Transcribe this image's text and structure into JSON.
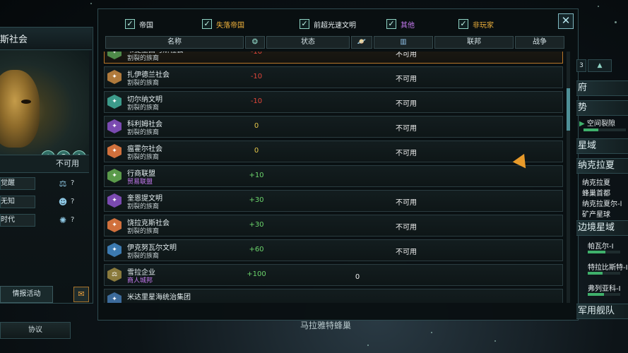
{
  "left_panel": {
    "title": "斯社会",
    "status_value": "不可用",
    "attributes": [
      {
        "label": "觉醒",
        "icon": "scale-icon",
        "glyph": "⚖",
        "value": "?"
      },
      {
        "label": "无知",
        "icon": "person-icon",
        "glyph": "☻",
        "value": "?"
      },
      {
        "label": "时代",
        "icon": "mind-icon",
        "glyph": "✺",
        "value": "?"
      }
    ],
    "ethics": [
      {
        "icon": "balance-ethic-icon",
        "glyph": "⚖"
      },
      {
        "icon": "peace-ethic-icon",
        "glyph": "☮"
      },
      {
        "icon": "xenophile-ethic-icon",
        "glyph": "✿"
      }
    ],
    "intel_button": "情报活动",
    "protocol_tab": "协议"
  },
  "filters": [
    {
      "label": "帝国",
      "checked": true,
      "color": "#e6eef0"
    },
    {
      "label": "失落帝国",
      "checked": true,
      "color": "#f0b23c"
    },
    {
      "label": "前超光速文明",
      "checked": true,
      "color": "#e6eef0"
    },
    {
      "label": "其他",
      "checked": true,
      "color": "#c77bf2"
    },
    {
      "label": "非玩家",
      "checked": true,
      "color": "#f0b23c"
    }
  ],
  "close_label": "✕",
  "columns": {
    "name": "名称",
    "opinion_icon": "brain-icon",
    "opinion_glyph": "❂",
    "status": "状态",
    "planet_icon": "planet-icon",
    "planet_glyph": "🪐",
    "chart_icon": "bar-chart-icon",
    "chart_glyph": "▥",
    "federation": "联邦",
    "war": "战争"
  },
  "rows": [
    {
      "name": "韦提里西马斯社会",
      "sub": "割裂的族裔",
      "sub_purple": false,
      "opinion": "-10",
      "op_class": "op-neg",
      "status": "不可用",
      "extra": "",
      "icon_color": "#4f8a4a",
      "icon_glyph": "✦",
      "selected": true
    },
    {
      "name": "扎伊德兰社会",
      "sub": "割裂的族裔",
      "sub_purple": false,
      "opinion": "-10",
      "op_class": "op-neg",
      "status": "不可用",
      "extra": "",
      "icon_color": "#b07a3c",
      "icon_glyph": "✦",
      "selected": false
    },
    {
      "name": "切尔纳文明",
      "sub": "割裂的族裔",
      "sub_purple": false,
      "opinion": "-10",
      "op_class": "op-neg",
      "status": "不可用",
      "extra": "",
      "icon_color": "#3c9a8a",
      "icon_glyph": "✦",
      "selected": false
    },
    {
      "name": "科利姆社会",
      "sub": "割裂的族裔",
      "sub_purple": false,
      "opinion": "0",
      "op_class": "op-zero",
      "status": "不可用",
      "extra": "",
      "icon_color": "#7a4ab0",
      "icon_glyph": "✦",
      "selected": false
    },
    {
      "name": "瘟霍尔社会",
      "sub": "割裂的族裔",
      "sub_purple": false,
      "opinion": "0",
      "op_class": "op-zero",
      "status": "不可用",
      "extra": "",
      "icon_color": "#d0703c",
      "icon_glyph": "✦",
      "selected": false
    },
    {
      "name": "行商联盟",
      "sub": "贸易联盟",
      "sub_purple": true,
      "opinion": "+10",
      "op_class": "op-pos",
      "status": "",
      "extra": "",
      "icon_color": "#5a9a4a",
      "icon_glyph": "✦",
      "selected": false
    },
    {
      "name": "奎恩提文明",
      "sub": "割裂的族裔",
      "sub_purple": false,
      "opinion": "+30",
      "op_class": "op-pos",
      "status": "不可用",
      "extra": "",
      "icon_color": "#7a4ab0",
      "icon_glyph": "✦",
      "selected": false
    },
    {
      "name": "饶拉克斯社会",
      "sub": "割裂的族裔",
      "sub_purple": false,
      "opinion": "+30",
      "op_class": "op-pos",
      "status": "不可用",
      "extra": "",
      "icon_color": "#d0703c",
      "icon_glyph": "✦",
      "selected": false
    },
    {
      "name": "伊克努瓦尔文明",
      "sub": "割裂的族裔",
      "sub_purple": false,
      "opinion": "+60",
      "op_class": "op-pos",
      "status": "不可用",
      "extra": "",
      "icon_color": "#3c7ab0",
      "icon_glyph": "✦",
      "selected": false
    },
    {
      "name": "雪拉企业",
      "sub": "商人城邦",
      "sub_purple": true,
      "opinion": "+100",
      "op_class": "op-pos",
      "status": "",
      "extra": "0",
      "icon_color": "#8a7a3c",
      "icon_glyph": "⚖",
      "selected": false
    },
    {
      "name": "米达里星海统治集团",
      "sub": "",
      "sub_purple": false,
      "opinion": "",
      "op_class": "op-pos",
      "status": "",
      "extra": "",
      "icon_color": "#3c6a9a",
      "icon_glyph": "✦",
      "selected": false
    }
  ],
  "outliner": {
    "tab_count": "3",
    "sections": [
      {
        "label": "府"
      },
      {
        "label": "势"
      },
      {
        "label": "星域"
      },
      {
        "label": "纳克拉夏"
      },
      {
        "label": "边境星域"
      },
      {
        "label": "军用舰队"
      }
    ],
    "rift_label": "空间裂隙",
    "sector_items": [
      {
        "name": "纳克拉夏",
        "sub": "蜂巢首都"
      },
      {
        "name": "纳克拉夏尔-l",
        "sub": "矿产星球"
      }
    ],
    "border_items": [
      {
        "name": "帕瓦尔-I",
        "health": 0.55
      },
      {
        "name": "特拉比斯特-I",
        "health": 0.45
      },
      {
        "name": "弗列亚科-I",
        "health": 0.5
      }
    ]
  },
  "map_label": "马拉雅特蜂巢"
}
